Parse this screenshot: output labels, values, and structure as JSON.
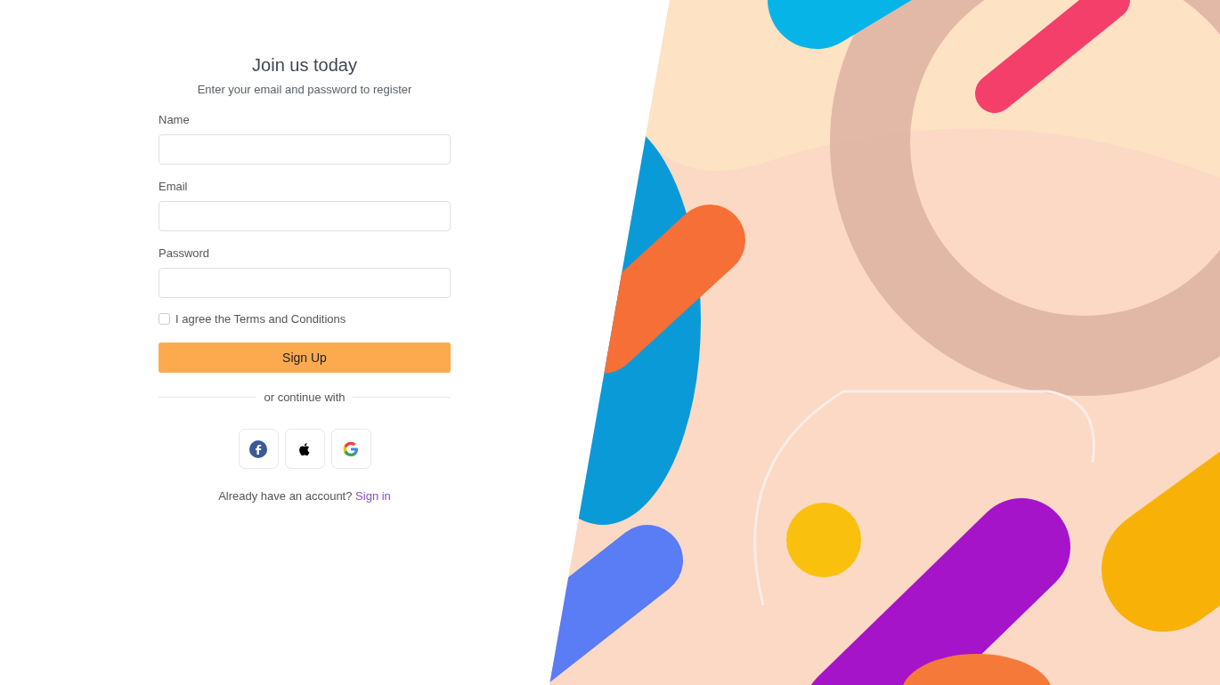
{
  "form": {
    "title": "Join us today",
    "subtitle": "Enter your email and password to register",
    "fields": [
      {
        "label": "Name"
      },
      {
        "label": "Email"
      },
      {
        "label": "Password"
      }
    ],
    "terms": {
      "label": "I agree the Terms and Conditions",
      "checked": false
    },
    "submit": "Sign Up",
    "divider": "or continue with",
    "social": [
      {
        "kind": "facebook"
      },
      {
        "kind": "apple"
      },
      {
        "kind": "google"
      }
    ],
    "footer": {
      "text": "Already have an account?",
      "link": "Sign in"
    }
  }
}
